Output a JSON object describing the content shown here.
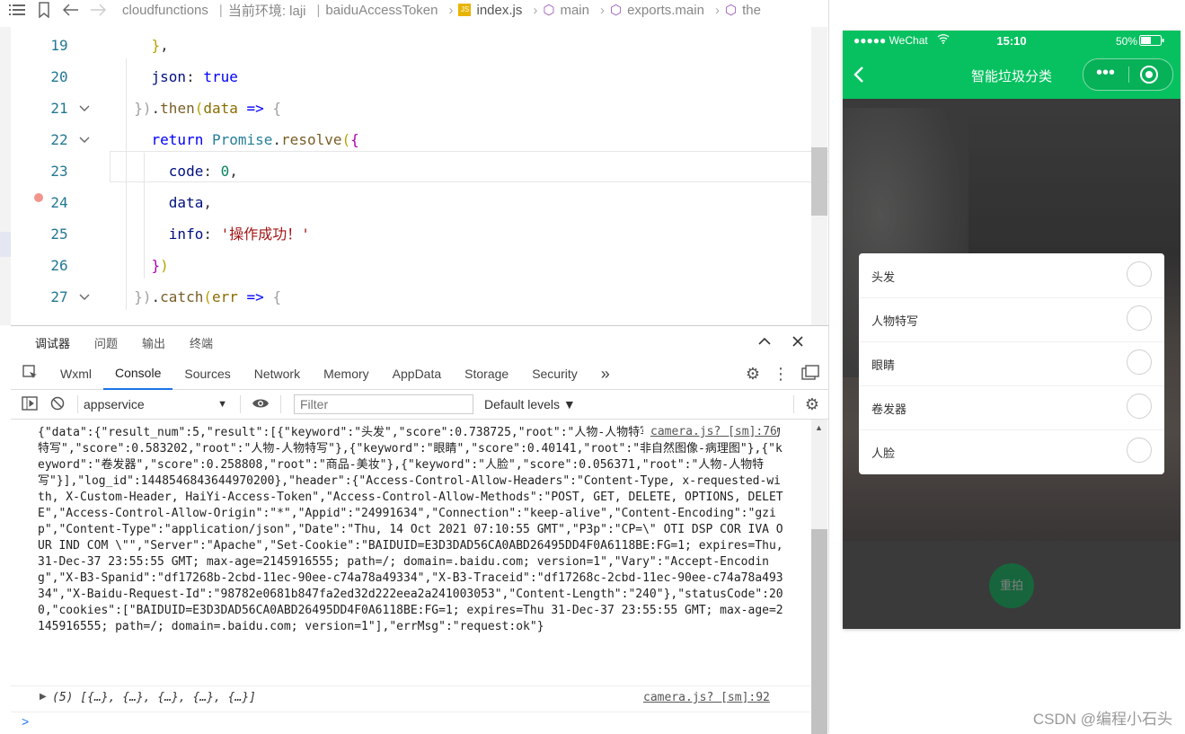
{
  "breadcrumb": {
    "items": [
      "cloudfunctions",
      "当前环境: laji",
      "baiduAccessToken",
      "index.js",
      "main",
      "exports.main",
      "the"
    ]
  },
  "editor": {
    "lines": [
      {
        "num": "19",
        "parts": [
          {
            "t": "    "
          },
          {
            "t": "}",
            "c": "brk"
          },
          {
            "t": ","
          }
        ]
      },
      {
        "num": "20",
        "parts": [
          {
            "t": "    "
          },
          {
            "t": "json",
            "c": "prop"
          },
          {
            "t": ": "
          },
          {
            "t": "true",
            "c": "kw"
          }
        ]
      },
      {
        "num": "21",
        "parts": [
          {
            "t": "  "
          },
          {
            "t": "})",
            "c": "dim"
          },
          {
            "t": "."
          },
          {
            "t": "then",
            "c": "fn"
          },
          {
            "t": "(",
            "c": "brk"
          },
          {
            "t": "data",
            "c": "var"
          },
          {
            "t": " "
          },
          {
            "t": "=>",
            "c": "kw"
          },
          {
            "t": " "
          },
          {
            "t": "{",
            "c": "dim"
          }
        ]
      },
      {
        "num": "22",
        "parts": [
          {
            "t": "    "
          },
          {
            "t": "return",
            "c": "kw"
          },
          {
            "t": " "
          },
          {
            "t": "Promise",
            "c": "obj"
          },
          {
            "t": "."
          },
          {
            "t": "resolve",
            "c": "fn"
          },
          {
            "t": "(",
            "c": "brk"
          },
          {
            "t": "{",
            "c": "brk2"
          }
        ]
      },
      {
        "num": "23",
        "parts": [
          {
            "t": "      "
          },
          {
            "t": "code",
            "c": "prop"
          },
          {
            "t": ": "
          },
          {
            "t": "0",
            "c": "num"
          },
          {
            "t": ","
          }
        ]
      },
      {
        "num": "24",
        "parts": [
          {
            "t": "      "
          },
          {
            "t": "data",
            "c": "prop"
          },
          {
            "t": ","
          }
        ]
      },
      {
        "num": "25",
        "parts": [
          {
            "t": "      "
          },
          {
            "t": "info",
            "c": "prop"
          },
          {
            "t": ": "
          },
          {
            "t": "'操作成功！'",
            "c": "str"
          }
        ]
      },
      {
        "num": "26",
        "parts": [
          {
            "t": "    "
          },
          {
            "t": "}",
            "c": "brk2"
          },
          {
            "t": ")",
            "c": "brk"
          }
        ]
      },
      {
        "num": "27",
        "parts": [
          {
            "t": "  "
          },
          {
            "t": "})",
            "c": "dim"
          },
          {
            "t": "."
          },
          {
            "t": "catch",
            "c": "fn"
          },
          {
            "t": "(",
            "c": "brk"
          },
          {
            "t": "err",
            "c": "var"
          },
          {
            "t": " "
          },
          {
            "t": "=>",
            "c": "kw"
          },
          {
            "t": " "
          },
          {
            "t": "{",
            "c": "dim"
          }
        ]
      }
    ]
  },
  "devtools": {
    "top_tabs": [
      "调试器",
      "问题",
      "输出",
      "终端"
    ],
    "panel_tabs": [
      "Wxml",
      "Console",
      "Sources",
      "Network",
      "Memory",
      "AppData",
      "Storage",
      "Security"
    ],
    "active_panel": "Console",
    "more_tabs": "»",
    "context": "appservice",
    "filter_placeholder": "Filter",
    "levels": "Default levels ▼"
  },
  "console": {
    "log1_text": "{\"data\":{\"result_num\":5,\"result\":[{\"keyword\":\"头发\",\"score\":0.738725,\"root\":\"人物-人物特写\"},{\"keyword\":\"人物特写\",\"score\":0.583202,\"root\":\"人物-人物特写\"},{\"keyword\":\"眼睛\",\"score\":0.40141,\"root\":\"非自然图像-病理图\"},{\"keyword\":\"卷发器\",\"score\":0.258808,\"root\":\"商品-美妆\"},{\"keyword\":\"人脸\",\"score\":0.056371,\"root\":\"人物-人物特写\"}],\"log_id\":1448546843644970200},\"header\":{\"Access-Control-Allow-Headers\":\"Content-Type, x-requested-with, X-Custom-Header, HaiYi-Access-Token\",\"Access-Control-Allow-Methods\":\"POST, GET, DELETE, OPTIONS, DELETE\",\"Access-Control-Allow-Origin\":\"*\",\"Appid\":\"24991634\",\"Connection\":\"keep-alive\",\"Content-Encoding\":\"gzip\",\"Content-Type\":\"application/json\",\"Date\":\"Thu, 14 Oct 2021 07:10:55 GMT\",\"P3p\":\"CP=\\\" OTI DSP COR IVA OUR IND COM \\\"\",\"Server\":\"Apache\",\"Set-Cookie\":\"BAIDUID=E3D3DAD56CA0ABD26495DD4F0A6118BE:FG=1; expires=Thu, 31-Dec-37 23:55:55 GMT; max-age=2145916555; path=/; domain=.baidu.com; version=1\",\"Vary\":\"Accept-Encoding\",\"X-B3-Spanid\":\"df17268b-2cbd-11ec-90ee-c74a78a49334\",\"X-B3-Traceid\":\"df17268c-2cbd-11ec-90ee-c74a78a49334\",\"X-Baidu-Request-Id\":\"98782e0681b847fa2ed32d222eea2a241003053\",\"Content-Length\":\"240\"},\"statusCode\":200,\"cookies\":[\"BAIDUID=E3D3DAD56CA0ABD26495DD4F0A6118BE:FG=1; expires=Thu 31-Dec-37 23:55:55 GMT; max-age=2145916555; path=/; domain=.baidu.com; version=1\"],\"errMsg\":\"request:ok\"}",
    "log1_src": "camera.js? [sm]:76",
    "log2_text": "(5) [{…}, {…}, {…}, {…}, {…}]",
    "log2_src": "camera.js? [sm]:92",
    "prompt": ">"
  },
  "phone": {
    "carrier": "●●●●● WeChat",
    "time": "15:10",
    "battery": "50%",
    "nav_title": "智能垃圾分类",
    "results": [
      "头发",
      "人物特写",
      "眼睛",
      "卷发器",
      "人脸"
    ],
    "retake_label": "重拍",
    "brand_color": "#07c160"
  },
  "watermark": "CSDN @编程小石头"
}
